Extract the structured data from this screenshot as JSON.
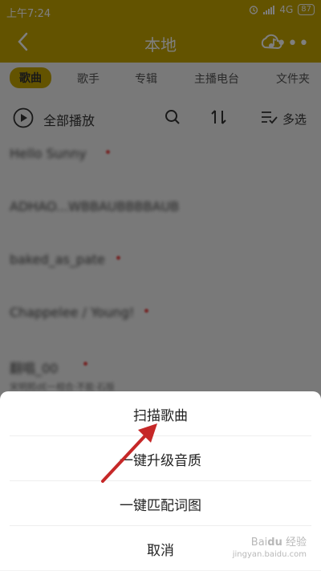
{
  "status": {
    "time": "上午7:24",
    "network": "4G",
    "battery": "87"
  },
  "header": {
    "title": "本地",
    "back_icon": "chevron-left-icon",
    "cloud_icon": "cloud-music-icon",
    "more_icon": "more-icon"
  },
  "tabs": [
    {
      "label": "歌曲",
      "active": true
    },
    {
      "label": "歌手",
      "active": false
    },
    {
      "label": "专辑",
      "active": false
    },
    {
      "label": "主播电台",
      "active": false
    },
    {
      "label": "文件夹",
      "active": false
    }
  ],
  "toolbar": {
    "play_all": "全部播放",
    "multi_select": "多选"
  },
  "songs": [
    {
      "name": "Hello Sunny",
      "sub": ""
    },
    {
      "name": "ADHAO...WBBAUBBBBAUB",
      "sub": ""
    },
    {
      "name": "baked_as_pate",
      "sub": ""
    },
    {
      "name": "Chappelee / Young!",
      "sub": ""
    },
    {
      "name": "翻唱_00",
      "sub": "宋明熙dE一相合·不能·石版"
    }
  ],
  "sheet": {
    "options": [
      "扫描歌曲",
      "一键升级音质",
      "一键匹配词图",
      "取消"
    ]
  },
  "colors": {
    "accent": "#c6a600",
    "arrow": "#c62828"
  }
}
